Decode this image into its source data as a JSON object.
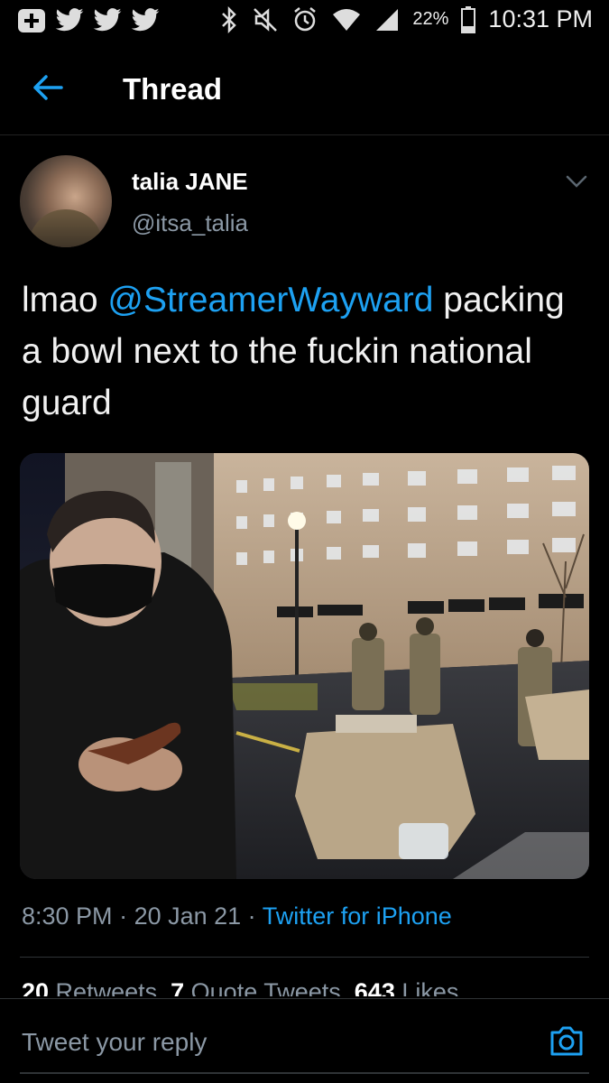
{
  "status_bar": {
    "battery": "22%",
    "time": "10:31 PM"
  },
  "header": {
    "title": "Thread"
  },
  "tweet": {
    "author": {
      "display_name": "talia JANE",
      "handle": "@itsa_talia"
    },
    "text_before": "lmao ",
    "mention": "@StreamerWayward",
    "text_after": " packing a bowl next to the fuckin national guard",
    "time": "8:30 PM",
    "date": "20 Jan 21",
    "source": "Twitter for iPhone",
    "separator": " · "
  },
  "stats": {
    "retweets_count": "20",
    "retweets_label": " Retweets",
    "quote_count": "7",
    "quote_label": " Quote Tweets",
    "likes_count": "643",
    "likes_label": " Likes"
  },
  "reply": {
    "placeholder": "Tweet your reply"
  },
  "colors": {
    "accent": "#1da1f2",
    "muted": "#8b98a5",
    "background": "#000000"
  }
}
